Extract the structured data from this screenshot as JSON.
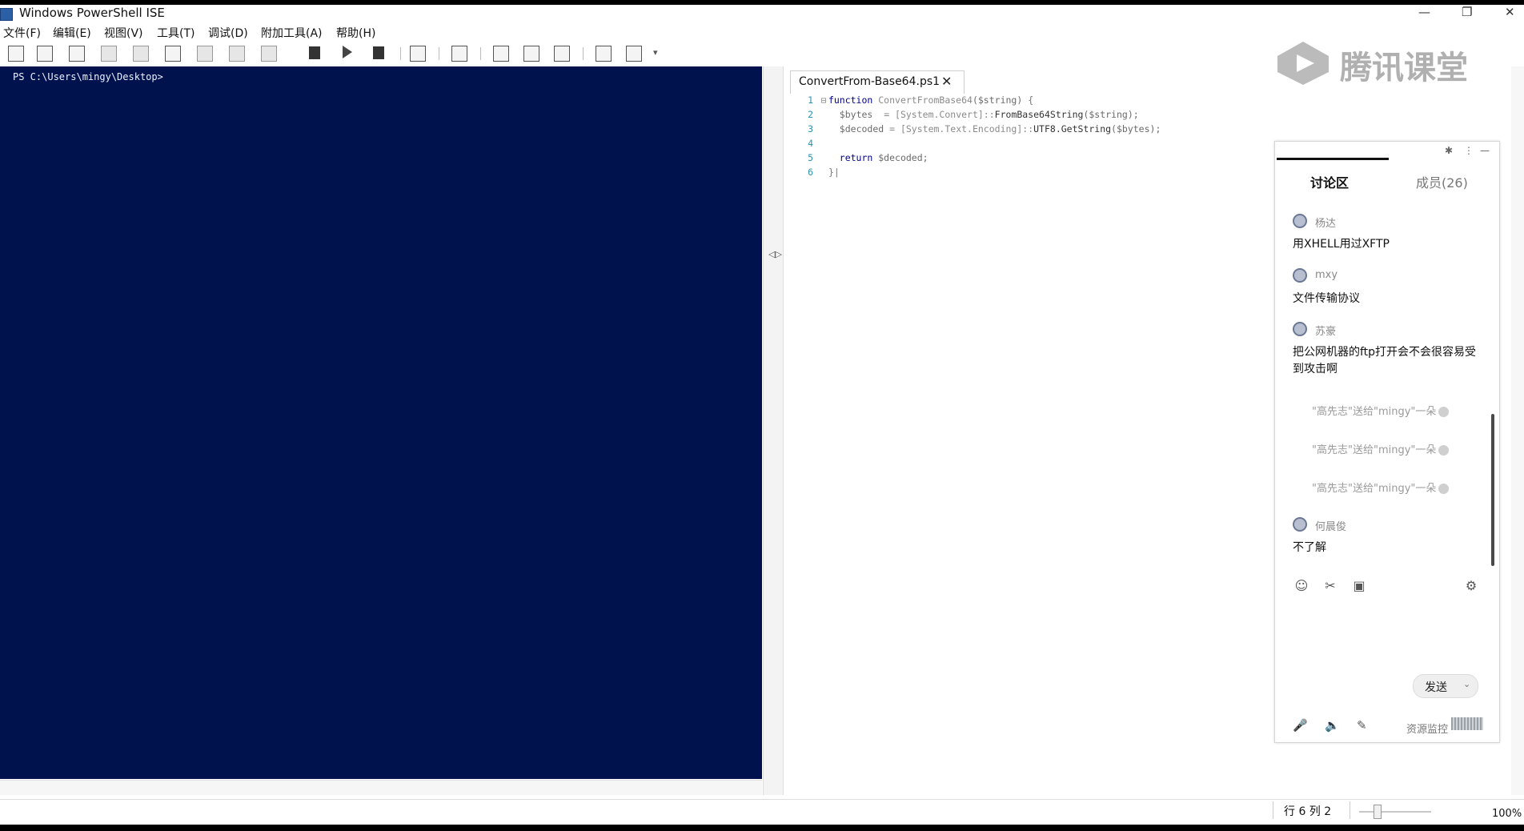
{
  "window": {
    "title": "Windows PowerShell ISE",
    "controls": [
      "—",
      "❐",
      "✕"
    ]
  },
  "menu": [
    "文件(F)",
    "编辑(E)",
    "视图(V)",
    "工具(T)",
    "调试(D)",
    "附加工具(A)",
    "帮助(H)"
  ],
  "toolbar": {
    "overflow": "▾",
    "icons": [
      "new-file-icon",
      "open-file-icon",
      "save-icon",
      "cut-icon",
      "copy-icon",
      "paste-icon",
      "clear-icon",
      "undo-icon",
      "redo-icon",
      "run-icon",
      "run-selection-icon",
      "stop-icon",
      "remote-icon",
      "powershell-tab-icon",
      "layout-top-icon",
      "layout-right-icon",
      "layout-max-icon",
      "commands-icon",
      "addon-icon"
    ]
  },
  "console": {
    "prompt": "PS C:\\Users\\mingy\\Desktop>"
  },
  "splitter": {
    "arrows": "◁▷"
  },
  "editor": {
    "tab_label": "ConvertFrom-Base64.ps1",
    "tab_close": "✕",
    "lines": [
      {
        "num": "1",
        "fold": "⊟",
        "kw": "function ",
        "a": "ConvertFromBase64",
        "b": "($string) ",
        "c": "{",
        "d": ""
      },
      {
        "num": "2",
        "fold": "",
        "kw": "  ",
        "a": "$bytes  ",
        "b": "= [System.Convert]::",
        "c": "FromBase64String",
        "d": "($string);"
      },
      {
        "num": "3",
        "fold": "",
        "kw": "  ",
        "a": "$decoded ",
        "b": "= [System.Text.Encoding]::",
        "c": "UTF8.GetString",
        "d": "($bytes);"
      },
      {
        "num": "4",
        "fold": "",
        "kw": "",
        "a": "",
        "b": "",
        "c": "",
        "d": ""
      },
      {
        "num": "5",
        "fold": "",
        "kw": "  return ",
        "a": "$decoded;",
        "b": "",
        "c": "",
        "d": ""
      },
      {
        "num": "6",
        "fold": "",
        "kw": "",
        "a": "",
        "b": "",
        "c": "}|",
        "d": ""
      }
    ]
  },
  "watermark": {
    "text": "腾讯课堂"
  },
  "chat": {
    "actions": [
      "✱",
      "⋮",
      "—"
    ],
    "tab_discussion": "讨论区",
    "tab_members": "成员(26)",
    "messages": [
      {
        "name": "杨达",
        "text": "用XHELL用过XFTP"
      },
      {
        "name": "mxy",
        "text": "文件传输协议"
      },
      {
        "name": "苏豪",
        "text": "把公网机器的ftp打开会不会很容易受到攻击啊"
      },
      {
        "name": "何晨俊",
        "text": "不了解"
      }
    ],
    "gifts": [
      "\"高先志\"送给\"mingy\"一朵",
      "\"高先志\"送给\"mingy\"一朵",
      "\"高先志\"送给\"mingy\"一朵"
    ],
    "tools": [
      "☺",
      "✂",
      "▣",
      "⚙"
    ],
    "send_label": "发送",
    "send_caret": "⌄",
    "bottom_icons": [
      "🎤",
      "🔈",
      "✎"
    ],
    "resource_label": "资源监控"
  },
  "status": {
    "position": "行 6  列 2",
    "zoom": "100%"
  }
}
